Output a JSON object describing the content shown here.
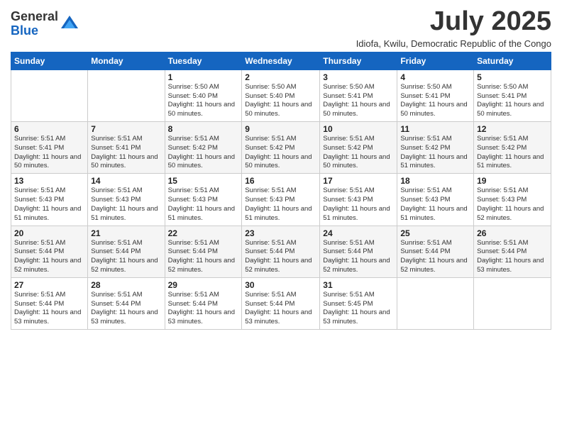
{
  "logo": {
    "general": "General",
    "blue": "Blue"
  },
  "title": "July 2025",
  "subtitle": "Idiofa, Kwilu, Democratic Republic of the Congo",
  "days_of_week": [
    "Sunday",
    "Monday",
    "Tuesday",
    "Wednesday",
    "Thursday",
    "Friday",
    "Saturday"
  ],
  "weeks": [
    [
      {
        "day": "",
        "info": ""
      },
      {
        "day": "",
        "info": ""
      },
      {
        "day": "1",
        "info": "Sunrise: 5:50 AM\nSunset: 5:40 PM\nDaylight: 11 hours and 50 minutes."
      },
      {
        "day": "2",
        "info": "Sunrise: 5:50 AM\nSunset: 5:40 PM\nDaylight: 11 hours and 50 minutes."
      },
      {
        "day": "3",
        "info": "Sunrise: 5:50 AM\nSunset: 5:41 PM\nDaylight: 11 hours and 50 minutes."
      },
      {
        "day": "4",
        "info": "Sunrise: 5:50 AM\nSunset: 5:41 PM\nDaylight: 11 hours and 50 minutes."
      },
      {
        "day": "5",
        "info": "Sunrise: 5:50 AM\nSunset: 5:41 PM\nDaylight: 11 hours and 50 minutes."
      }
    ],
    [
      {
        "day": "6",
        "info": "Sunrise: 5:51 AM\nSunset: 5:41 PM\nDaylight: 11 hours and 50 minutes."
      },
      {
        "day": "7",
        "info": "Sunrise: 5:51 AM\nSunset: 5:41 PM\nDaylight: 11 hours and 50 minutes."
      },
      {
        "day": "8",
        "info": "Sunrise: 5:51 AM\nSunset: 5:42 PM\nDaylight: 11 hours and 50 minutes."
      },
      {
        "day": "9",
        "info": "Sunrise: 5:51 AM\nSunset: 5:42 PM\nDaylight: 11 hours and 50 minutes."
      },
      {
        "day": "10",
        "info": "Sunrise: 5:51 AM\nSunset: 5:42 PM\nDaylight: 11 hours and 50 minutes."
      },
      {
        "day": "11",
        "info": "Sunrise: 5:51 AM\nSunset: 5:42 PM\nDaylight: 11 hours and 51 minutes."
      },
      {
        "day": "12",
        "info": "Sunrise: 5:51 AM\nSunset: 5:42 PM\nDaylight: 11 hours and 51 minutes."
      }
    ],
    [
      {
        "day": "13",
        "info": "Sunrise: 5:51 AM\nSunset: 5:43 PM\nDaylight: 11 hours and 51 minutes."
      },
      {
        "day": "14",
        "info": "Sunrise: 5:51 AM\nSunset: 5:43 PM\nDaylight: 11 hours and 51 minutes."
      },
      {
        "day": "15",
        "info": "Sunrise: 5:51 AM\nSunset: 5:43 PM\nDaylight: 11 hours and 51 minutes."
      },
      {
        "day": "16",
        "info": "Sunrise: 5:51 AM\nSunset: 5:43 PM\nDaylight: 11 hours and 51 minutes."
      },
      {
        "day": "17",
        "info": "Sunrise: 5:51 AM\nSunset: 5:43 PM\nDaylight: 11 hours and 51 minutes."
      },
      {
        "day": "18",
        "info": "Sunrise: 5:51 AM\nSunset: 5:43 PM\nDaylight: 11 hours and 51 minutes."
      },
      {
        "day": "19",
        "info": "Sunrise: 5:51 AM\nSunset: 5:43 PM\nDaylight: 11 hours and 52 minutes."
      }
    ],
    [
      {
        "day": "20",
        "info": "Sunrise: 5:51 AM\nSunset: 5:44 PM\nDaylight: 11 hours and 52 minutes."
      },
      {
        "day": "21",
        "info": "Sunrise: 5:51 AM\nSunset: 5:44 PM\nDaylight: 11 hours and 52 minutes."
      },
      {
        "day": "22",
        "info": "Sunrise: 5:51 AM\nSunset: 5:44 PM\nDaylight: 11 hours and 52 minutes."
      },
      {
        "day": "23",
        "info": "Sunrise: 5:51 AM\nSunset: 5:44 PM\nDaylight: 11 hours and 52 minutes."
      },
      {
        "day": "24",
        "info": "Sunrise: 5:51 AM\nSunset: 5:44 PM\nDaylight: 11 hours and 52 minutes."
      },
      {
        "day": "25",
        "info": "Sunrise: 5:51 AM\nSunset: 5:44 PM\nDaylight: 11 hours and 52 minutes."
      },
      {
        "day": "26",
        "info": "Sunrise: 5:51 AM\nSunset: 5:44 PM\nDaylight: 11 hours and 53 minutes."
      }
    ],
    [
      {
        "day": "27",
        "info": "Sunrise: 5:51 AM\nSunset: 5:44 PM\nDaylight: 11 hours and 53 minutes."
      },
      {
        "day": "28",
        "info": "Sunrise: 5:51 AM\nSunset: 5:44 PM\nDaylight: 11 hours and 53 minutes."
      },
      {
        "day": "29",
        "info": "Sunrise: 5:51 AM\nSunset: 5:44 PM\nDaylight: 11 hours and 53 minutes."
      },
      {
        "day": "30",
        "info": "Sunrise: 5:51 AM\nSunset: 5:44 PM\nDaylight: 11 hours and 53 minutes."
      },
      {
        "day": "31",
        "info": "Sunrise: 5:51 AM\nSunset: 5:45 PM\nDaylight: 11 hours and 53 minutes."
      },
      {
        "day": "",
        "info": ""
      },
      {
        "day": "",
        "info": ""
      }
    ]
  ]
}
